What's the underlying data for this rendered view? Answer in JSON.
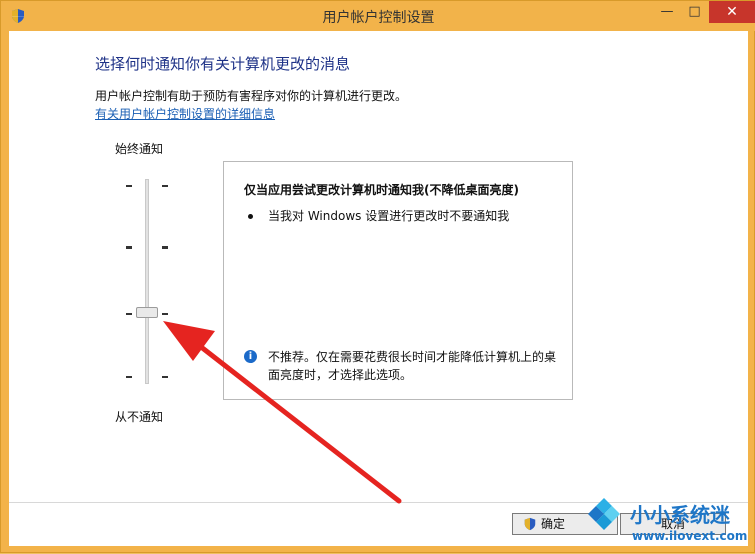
{
  "window": {
    "title": "用户帐户控制设置",
    "buttons": {
      "minimize": "—",
      "maximize": "□",
      "close": "✕"
    }
  },
  "page": {
    "heading": "选择何时通知你有关计算机更改的消息",
    "description": "用户帐户控制有助于预防有害程序对你的计算机进行更改。",
    "link": "有关用户帐户控制设置的详细信息"
  },
  "slider": {
    "top_label": "始终通知",
    "bottom_label": "从不通知",
    "level": 3,
    "levels": 4
  },
  "info": {
    "title": "仅当应用尝试更改计算机时通知我(不降低桌面亮度)",
    "bullet": "当我对 Windows 设置进行更改时不要通知我",
    "warning": "不推荐。仅在需要花费很长时间才能降低计算机上的桌面亮度时，才选择此选项。"
  },
  "buttons": {
    "ok": "确定",
    "cancel": "取消"
  },
  "watermark": {
    "name": "小小系统迷",
    "url": "www.ilovext.com"
  },
  "colors": {
    "titlebar": "#f2b34a",
    "close": "#c7352b",
    "heading": "#1e3287",
    "link": "#1a5fb4",
    "arrow": "#e52420"
  }
}
